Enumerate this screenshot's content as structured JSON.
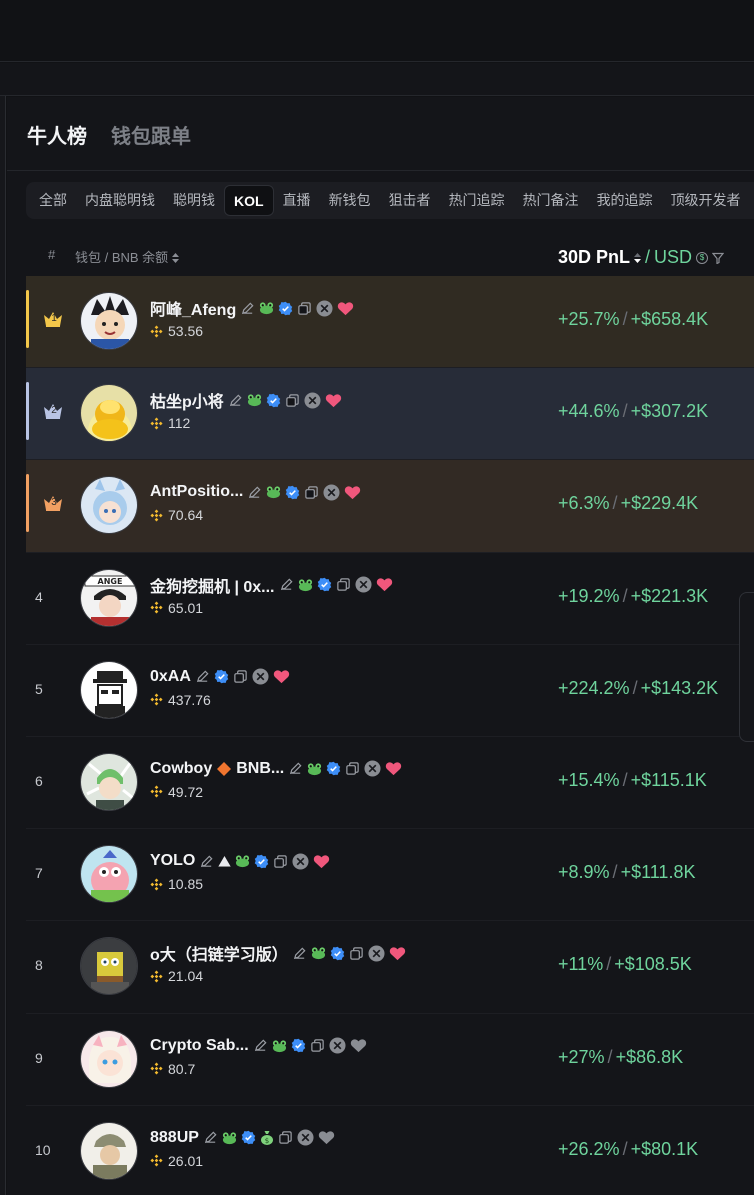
{
  "header": {
    "title": "牛人榜",
    "secondary": "钱包跟单"
  },
  "tabs": [
    "全部",
    "内盘聪明钱",
    "聪明钱",
    "KOL",
    "直播",
    "新钱包",
    "狙击者",
    "热门追踪",
    "热门备注",
    "我的追踪",
    "顶级开发者"
  ],
  "active_tab": "KOL",
  "columns": {
    "hash": "#",
    "wallet": "钱包 / BNB 余额",
    "pnl": "30D PnL",
    "pnl_sep": "/",
    "currency": "USD"
  },
  "rows": [
    {
      "rank": "1",
      "name": "阿峰_Afeng",
      "balance": "53.56",
      "pct": "+25.7%",
      "usd": "+$658.4K",
      "liked": true
    },
    {
      "rank": "2",
      "name": "枯坐p小将",
      "balance": "112",
      "pct": "+44.6%",
      "usd": "+$307.2K",
      "liked": true
    },
    {
      "rank": "3",
      "name": "AntPositio...",
      "balance": "70.64",
      "pct": "+6.3%",
      "usd": "+$229.4K",
      "liked": true
    },
    {
      "rank": "4",
      "name": "金狗挖掘机 | 0x...",
      "balance": "65.01",
      "pct": "+19.2%",
      "usd": "+$221.3K",
      "liked": true
    },
    {
      "rank": "5",
      "name": "0xAA",
      "balance": "437.76",
      "pct": "+224.2%",
      "usd": "+$143.2K",
      "liked": true
    },
    {
      "rank": "6",
      "name": "Cowboy",
      "name_suffix": "BNB...",
      "balance": "49.72",
      "pct": "+15.4%",
      "usd": "+$115.1K",
      "liked": true
    },
    {
      "rank": "7",
      "name": "YOLO",
      "balance": "10.85",
      "pct": "+8.9%",
      "usd": "+$111.8K",
      "liked": true
    },
    {
      "rank": "8",
      "name": "o大（扫链学习版）",
      "balance": "21.04",
      "pct": "+11%",
      "usd": "+$108.5K",
      "liked": true
    },
    {
      "rank": "9",
      "name": "Crypto Sab...",
      "balance": "80.7",
      "pct": "+27%",
      "usd": "+$86.8K",
      "liked": false
    },
    {
      "rank": "10",
      "name": "888UP",
      "balance": "26.01",
      "pct": "+26.2%",
      "usd": "+$80.1K",
      "liked": false
    }
  ],
  "colors": {
    "gain": "#6fd49d",
    "gold": "#f3c74a",
    "silver": "#b9c4e4",
    "bronze": "#f2a062",
    "heart": "#f0577c",
    "verified": "#3d8ef7"
  }
}
